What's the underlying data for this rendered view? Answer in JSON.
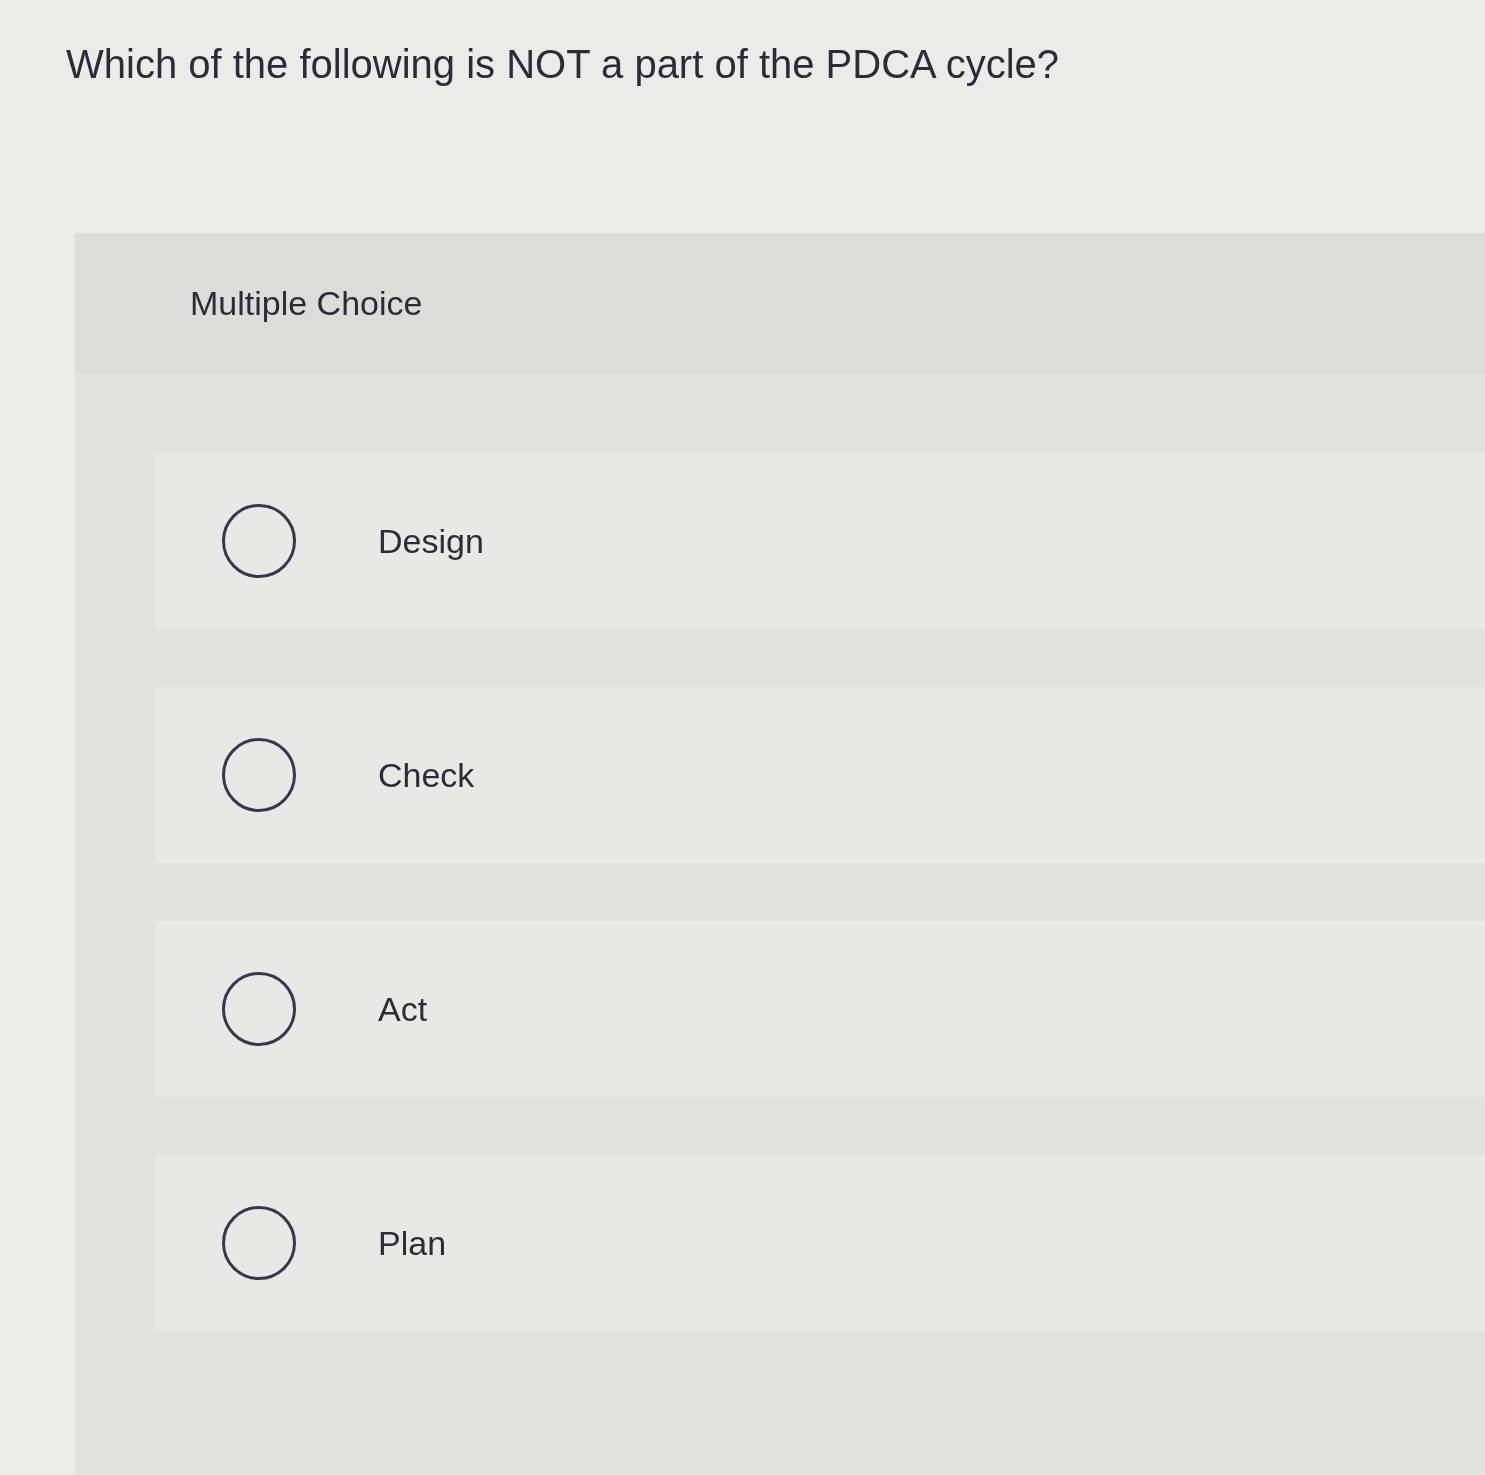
{
  "question": "Which of the following is NOT a part of the PDCA cycle?",
  "panel": {
    "header": "Multiple Choice"
  },
  "options": [
    {
      "label": "Design",
      "selected": false
    },
    {
      "label": "Check",
      "selected": false
    },
    {
      "label": "Act",
      "selected": false
    },
    {
      "label": "Plan",
      "selected": false
    }
  ]
}
